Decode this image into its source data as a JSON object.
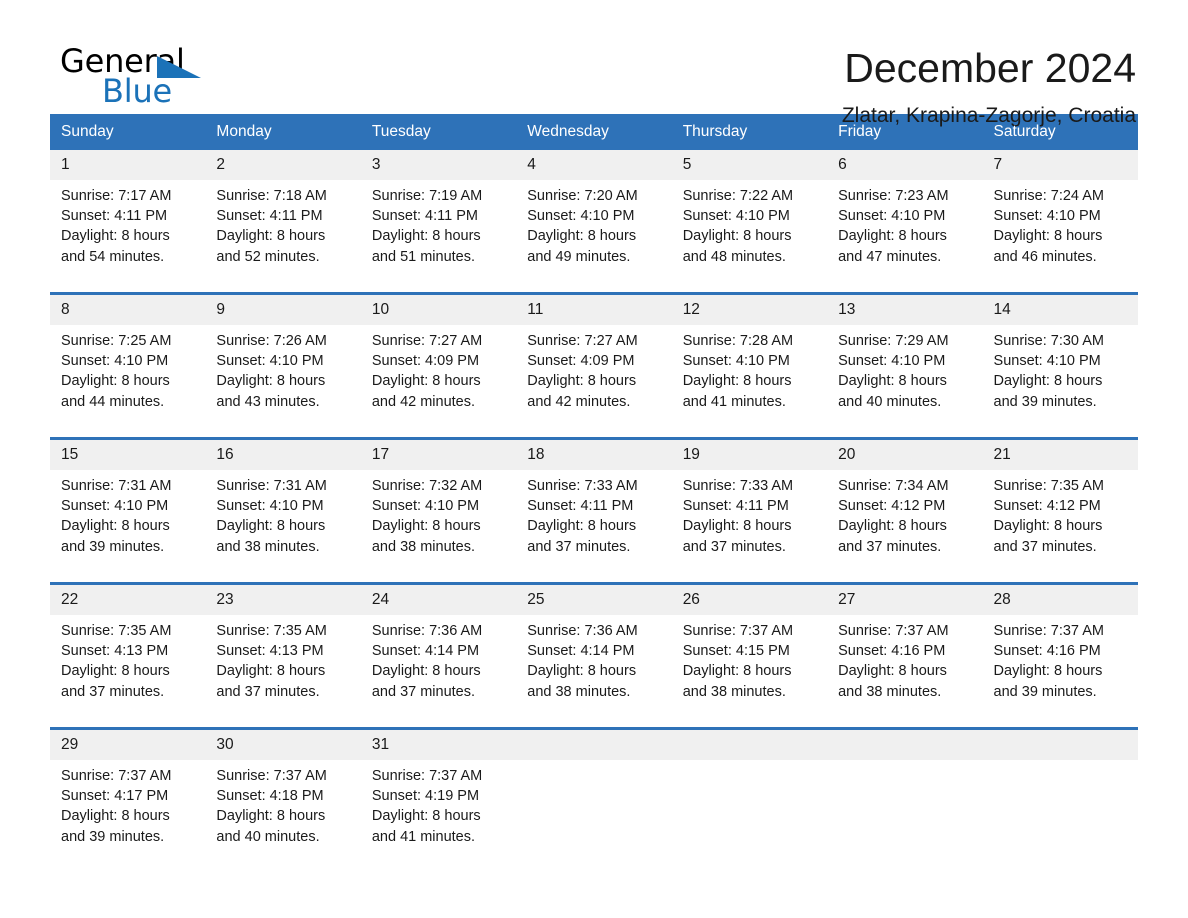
{
  "brand": {
    "word_one": "General",
    "word_two": "Blue",
    "accent_color": "#1b72b8"
  },
  "header": {
    "title": "December 2024",
    "location": "Zlatar, Krapina-Zagorje, Croatia"
  },
  "calendar": {
    "header_bg": "#2e72b8",
    "daynum_bg": "#f0f0f0",
    "weekdays": [
      "Sunday",
      "Monday",
      "Tuesday",
      "Wednesday",
      "Thursday",
      "Friday",
      "Saturday"
    ],
    "weeks": [
      [
        {
          "day": "1",
          "sunrise": "Sunrise: 7:17 AM",
          "sunset": "Sunset: 4:11 PM",
          "daylight_1": "Daylight: 8 hours",
          "daylight_2": "and 54 minutes."
        },
        {
          "day": "2",
          "sunrise": "Sunrise: 7:18 AM",
          "sunset": "Sunset: 4:11 PM",
          "daylight_1": "Daylight: 8 hours",
          "daylight_2": "and 52 minutes."
        },
        {
          "day": "3",
          "sunrise": "Sunrise: 7:19 AM",
          "sunset": "Sunset: 4:11 PM",
          "daylight_1": "Daylight: 8 hours",
          "daylight_2": "and 51 minutes."
        },
        {
          "day": "4",
          "sunrise": "Sunrise: 7:20 AM",
          "sunset": "Sunset: 4:10 PM",
          "daylight_1": "Daylight: 8 hours",
          "daylight_2": "and 49 minutes."
        },
        {
          "day": "5",
          "sunrise": "Sunrise: 7:22 AM",
          "sunset": "Sunset: 4:10 PM",
          "daylight_1": "Daylight: 8 hours",
          "daylight_2": "and 48 minutes."
        },
        {
          "day": "6",
          "sunrise": "Sunrise: 7:23 AM",
          "sunset": "Sunset: 4:10 PM",
          "daylight_1": "Daylight: 8 hours",
          "daylight_2": "and 47 minutes."
        },
        {
          "day": "7",
          "sunrise": "Sunrise: 7:24 AM",
          "sunset": "Sunset: 4:10 PM",
          "daylight_1": "Daylight: 8 hours",
          "daylight_2": "and 46 minutes."
        }
      ],
      [
        {
          "day": "8",
          "sunrise": "Sunrise: 7:25 AM",
          "sunset": "Sunset: 4:10 PM",
          "daylight_1": "Daylight: 8 hours",
          "daylight_2": "and 44 minutes."
        },
        {
          "day": "9",
          "sunrise": "Sunrise: 7:26 AM",
          "sunset": "Sunset: 4:10 PM",
          "daylight_1": "Daylight: 8 hours",
          "daylight_2": "and 43 minutes."
        },
        {
          "day": "10",
          "sunrise": "Sunrise: 7:27 AM",
          "sunset": "Sunset: 4:09 PM",
          "daylight_1": "Daylight: 8 hours",
          "daylight_2": "and 42 minutes."
        },
        {
          "day": "11",
          "sunrise": "Sunrise: 7:27 AM",
          "sunset": "Sunset: 4:09 PM",
          "daylight_1": "Daylight: 8 hours",
          "daylight_2": "and 42 minutes."
        },
        {
          "day": "12",
          "sunrise": "Sunrise: 7:28 AM",
          "sunset": "Sunset: 4:10 PM",
          "daylight_1": "Daylight: 8 hours",
          "daylight_2": "and 41 minutes."
        },
        {
          "day": "13",
          "sunrise": "Sunrise: 7:29 AM",
          "sunset": "Sunset: 4:10 PM",
          "daylight_1": "Daylight: 8 hours",
          "daylight_2": "and 40 minutes."
        },
        {
          "day": "14",
          "sunrise": "Sunrise: 7:30 AM",
          "sunset": "Sunset: 4:10 PM",
          "daylight_1": "Daylight: 8 hours",
          "daylight_2": "and 39 minutes."
        }
      ],
      [
        {
          "day": "15",
          "sunrise": "Sunrise: 7:31 AM",
          "sunset": "Sunset: 4:10 PM",
          "daylight_1": "Daylight: 8 hours",
          "daylight_2": "and 39 minutes."
        },
        {
          "day": "16",
          "sunrise": "Sunrise: 7:31 AM",
          "sunset": "Sunset: 4:10 PM",
          "daylight_1": "Daylight: 8 hours",
          "daylight_2": "and 38 minutes."
        },
        {
          "day": "17",
          "sunrise": "Sunrise: 7:32 AM",
          "sunset": "Sunset: 4:10 PM",
          "daylight_1": "Daylight: 8 hours",
          "daylight_2": "and 38 minutes."
        },
        {
          "day": "18",
          "sunrise": "Sunrise: 7:33 AM",
          "sunset": "Sunset: 4:11 PM",
          "daylight_1": "Daylight: 8 hours",
          "daylight_2": "and 37 minutes."
        },
        {
          "day": "19",
          "sunrise": "Sunrise: 7:33 AM",
          "sunset": "Sunset: 4:11 PM",
          "daylight_1": "Daylight: 8 hours",
          "daylight_2": "and 37 minutes."
        },
        {
          "day": "20",
          "sunrise": "Sunrise: 7:34 AM",
          "sunset": "Sunset: 4:12 PM",
          "daylight_1": "Daylight: 8 hours",
          "daylight_2": "and 37 minutes."
        },
        {
          "day": "21",
          "sunrise": "Sunrise: 7:35 AM",
          "sunset": "Sunset: 4:12 PM",
          "daylight_1": "Daylight: 8 hours",
          "daylight_2": "and 37 minutes."
        }
      ],
      [
        {
          "day": "22",
          "sunrise": "Sunrise: 7:35 AM",
          "sunset": "Sunset: 4:13 PM",
          "daylight_1": "Daylight: 8 hours",
          "daylight_2": "and 37 minutes."
        },
        {
          "day": "23",
          "sunrise": "Sunrise: 7:35 AM",
          "sunset": "Sunset: 4:13 PM",
          "daylight_1": "Daylight: 8 hours",
          "daylight_2": "and 37 minutes."
        },
        {
          "day": "24",
          "sunrise": "Sunrise: 7:36 AM",
          "sunset": "Sunset: 4:14 PM",
          "daylight_1": "Daylight: 8 hours",
          "daylight_2": "and 37 minutes."
        },
        {
          "day": "25",
          "sunrise": "Sunrise: 7:36 AM",
          "sunset": "Sunset: 4:14 PM",
          "daylight_1": "Daylight: 8 hours",
          "daylight_2": "and 38 minutes."
        },
        {
          "day": "26",
          "sunrise": "Sunrise: 7:37 AM",
          "sunset": "Sunset: 4:15 PM",
          "daylight_1": "Daylight: 8 hours",
          "daylight_2": "and 38 minutes."
        },
        {
          "day": "27",
          "sunrise": "Sunrise: 7:37 AM",
          "sunset": "Sunset: 4:16 PM",
          "daylight_1": "Daylight: 8 hours",
          "daylight_2": "and 38 minutes."
        },
        {
          "day": "28",
          "sunrise": "Sunrise: 7:37 AM",
          "sunset": "Sunset: 4:16 PM",
          "daylight_1": "Daylight: 8 hours",
          "daylight_2": "and 39 minutes."
        }
      ],
      [
        {
          "day": "29",
          "sunrise": "Sunrise: 7:37 AM",
          "sunset": "Sunset: 4:17 PM",
          "daylight_1": "Daylight: 8 hours",
          "daylight_2": "and 39 minutes."
        },
        {
          "day": "30",
          "sunrise": "Sunrise: 7:37 AM",
          "sunset": "Sunset: 4:18 PM",
          "daylight_1": "Daylight: 8 hours",
          "daylight_2": "and 40 minutes."
        },
        {
          "day": "31",
          "sunrise": "Sunrise: 7:37 AM",
          "sunset": "Sunset: 4:19 PM",
          "daylight_1": "Daylight: 8 hours",
          "daylight_2": "and 41 minutes."
        },
        {
          "day": "",
          "sunrise": "",
          "sunset": "",
          "daylight_1": "",
          "daylight_2": ""
        },
        {
          "day": "",
          "sunrise": "",
          "sunset": "",
          "daylight_1": "",
          "daylight_2": ""
        },
        {
          "day": "",
          "sunrise": "",
          "sunset": "",
          "daylight_1": "",
          "daylight_2": ""
        },
        {
          "day": "",
          "sunrise": "",
          "sunset": "",
          "daylight_1": "",
          "daylight_2": ""
        }
      ]
    ]
  }
}
